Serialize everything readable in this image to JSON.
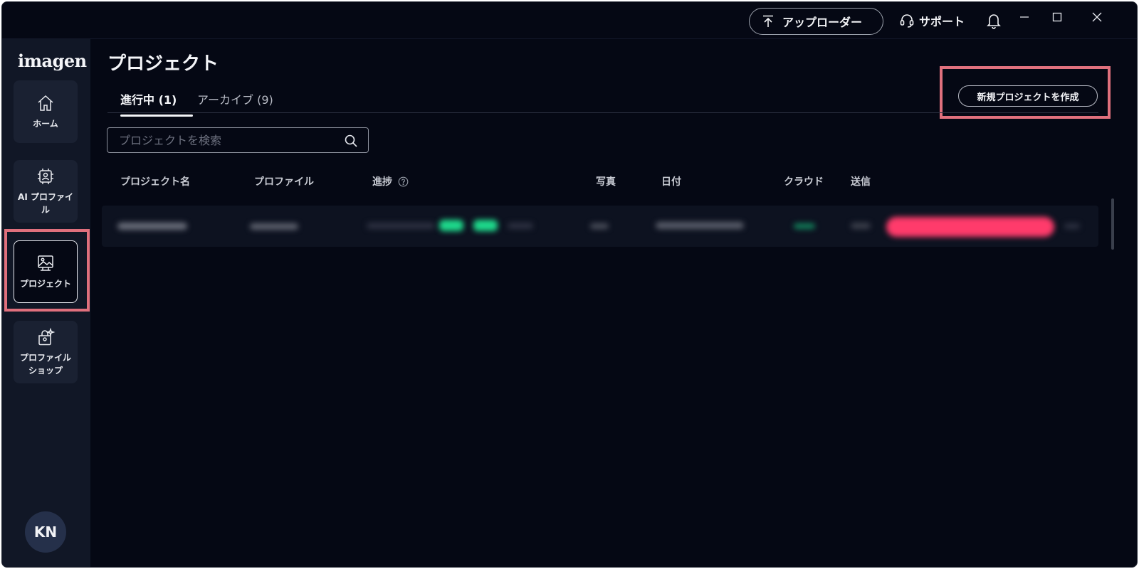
{
  "titlebar": {
    "uploader_label": "アップローダー",
    "support_label": "サポート"
  },
  "sidebar": {
    "logo": "imagen",
    "items": [
      {
        "label": "ホーム",
        "icon": "home-icon"
      },
      {
        "label": "AI プロファイル",
        "icon": "ai-profile-icon"
      },
      {
        "label": "プロジェクト",
        "icon": "project-icon",
        "active": true
      },
      {
        "label": "プロファイルショップ",
        "icon": "profile-shop-icon"
      }
    ],
    "avatar_initials": "KN"
  },
  "main": {
    "title": "プロジェクト",
    "tabs": [
      {
        "label": "進行中 (1)",
        "active": true
      },
      {
        "label": "アーカイブ (9)",
        "active": false
      }
    ],
    "new_project_label": "新規プロジェクトを作成",
    "search": {
      "placeholder": "プロジェクトを検索",
      "value": ""
    },
    "columns": [
      "プロジェクト名",
      "プロファイル",
      "進捗",
      "写真",
      "日付",
      "クラウド",
      "送信"
    ]
  },
  "colors": {
    "background": "#050814",
    "sidebar": "#111726",
    "highlight": "#e0707d",
    "progress_accent": "#1ed98b",
    "send_button": "#ff3b6b"
  }
}
